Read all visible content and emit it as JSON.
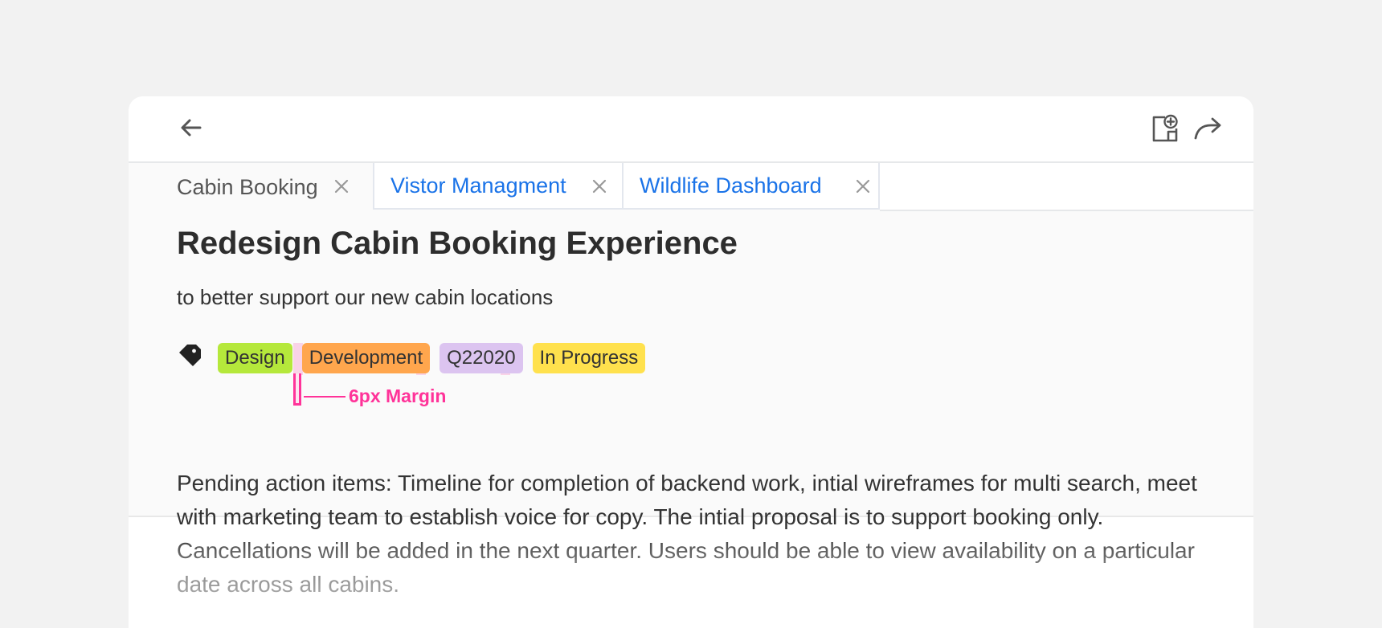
{
  "toolbar": {
    "back_icon": "arrow-left-icon",
    "add_note_icon": "note-add-icon",
    "share_icon": "share-forward-icon"
  },
  "tabs": [
    {
      "label": "Cabin Booking",
      "active": true,
      "close_icon": "close-icon"
    },
    {
      "label": "Vistor Managment",
      "active": false,
      "close_icon": "close-icon"
    },
    {
      "label": "Wildlife Dashboard",
      "active": false,
      "close_icon": "close-icon"
    }
  ],
  "page": {
    "title": "Redesign Cabin Booking Experience",
    "subtitle": "to better support our new cabin locations"
  },
  "tags": {
    "icon": "tag-icon",
    "items": [
      {
        "label": "Design",
        "color": "#b5e83b"
      },
      {
        "label": "Development",
        "color": "#ffa64d"
      },
      {
        "label": "Q22020",
        "color": "#dcc4f0"
      },
      {
        "label": "In Progress",
        "color": "#ffe14d"
      }
    ]
  },
  "annotation": {
    "label": "6px Margin",
    "color": "#ff3399"
  },
  "description": "Pending action items: Timeline for completion of backend work, intial wireframes for multi search, meet with marketing team to establish voice for copy. The intial proposal is to support booking only. Cancellations will be added in the next quarter. Users should be able to view availability on a particular date across all cabins.",
  "colors": {
    "tab_link": "#1a73e8",
    "text": "#333333",
    "background": "#f2f2f2"
  }
}
